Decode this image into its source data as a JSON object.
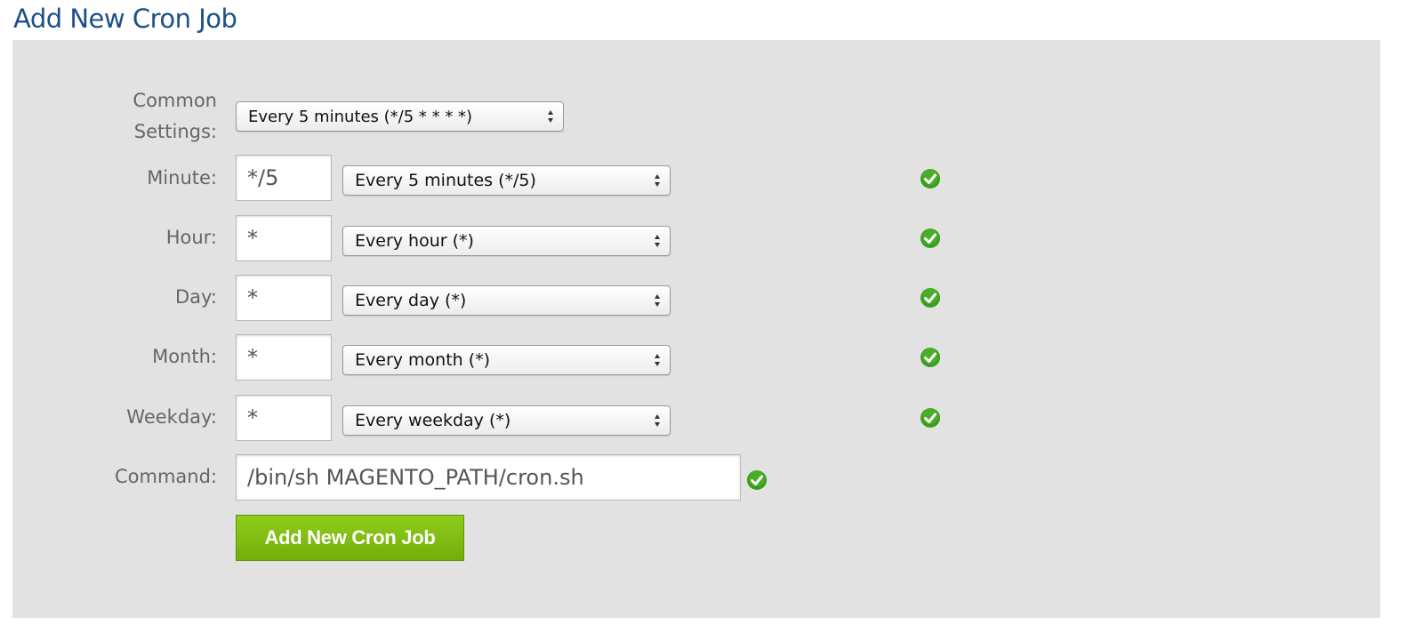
{
  "heading": "Add New Cron Job",
  "form": {
    "common": {
      "label_line1": "Common",
      "label_line2": "Settings:",
      "selected": "Every 5 minutes (*/5 * * * *)"
    },
    "minute": {
      "label": "Minute:",
      "value": "*/5",
      "selected": "Every 5 minutes (*/5)"
    },
    "hour": {
      "label": "Hour:",
      "value": "*",
      "selected": "Every hour (*)"
    },
    "day": {
      "label": "Day:",
      "value": "*",
      "selected": "Every day (*)"
    },
    "month": {
      "label": "Month:",
      "value": "*",
      "selected": "Every month (*)"
    },
    "weekday": {
      "label": "Weekday:",
      "value": "*",
      "selected": "Every weekday (*)"
    },
    "command": {
      "label": "Command:",
      "value": "/bin/sh MAGENTO_PATH/cron.sh"
    },
    "submit_label": "Add New Cron Job"
  },
  "icons": {
    "valid": "check-circle-icon",
    "select_arrows": "updown-arrows-icon"
  },
  "colors": {
    "heading": "#1d4f87",
    "panel": "#e2e2e2",
    "button": "#7fbf12",
    "check": "#3a9d1c"
  }
}
